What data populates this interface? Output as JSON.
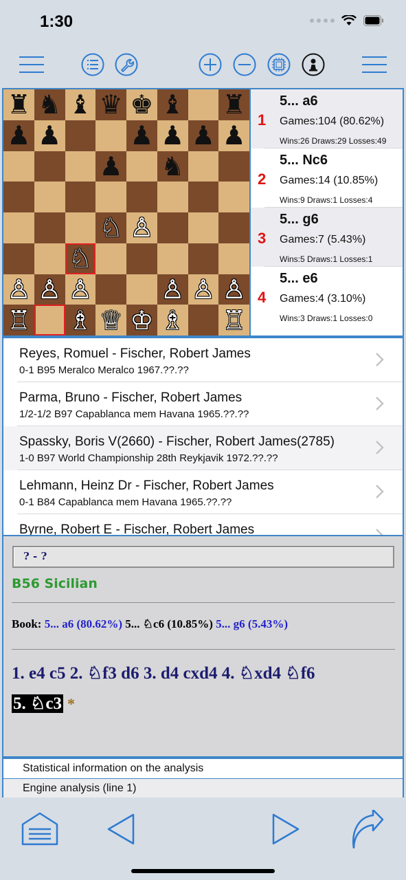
{
  "status": {
    "time": "1:30"
  },
  "colors": {
    "accent": "#3f86c8",
    "rank": "#e01414",
    "opening": "#2e9a32",
    "notation": "#1c1c6e"
  },
  "toolbar": {
    "icons": [
      "menu-icon",
      "list-icon",
      "wrench-icon",
      "zoom-in-icon",
      "zoom-out-icon",
      "engine-chip-icon",
      "pawn-icon",
      "menu-right-icon"
    ]
  },
  "board": {
    "rows": [
      [
        "♜",
        "♞",
        "♝",
        "♛",
        "♚",
        "♝",
        "",
        "♜"
      ],
      [
        "♟",
        "♟",
        "",
        "",
        "♟",
        "♟",
        "♟",
        "♟"
      ],
      [
        "",
        "",
        "",
        "♟",
        "",
        "♞",
        "",
        ""
      ],
      [
        "",
        "",
        "",
        "",
        "",
        "",
        "",
        ""
      ],
      [
        "",
        "",
        "",
        "♘",
        "♙",
        "",
        "",
        ""
      ],
      [
        "",
        "",
        "♘",
        "",
        "",
        "",
        "",
        ""
      ],
      [
        "♙",
        "♙",
        "♙",
        "",
        "",
        "♙",
        "♙",
        "♙"
      ],
      [
        "♖",
        "",
        "♗",
        "♕",
        "♔",
        "♗",
        "",
        "♖"
      ]
    ],
    "colors": [
      [
        "b",
        "b",
        "b",
        "b",
        "b",
        "b",
        "",
        "b"
      ],
      [
        "b",
        "b",
        "",
        "",
        "b",
        "b",
        "b",
        "b"
      ],
      [
        "",
        "",
        "",
        "b",
        "",
        "b",
        "",
        ""
      ],
      [
        "",
        "",
        "",
        "",
        "",
        "",
        "",
        ""
      ],
      [
        "",
        "",
        "",
        "w",
        "w",
        "",
        "",
        ""
      ],
      [
        "",
        "",
        "w",
        "",
        "",
        "",
        "",
        ""
      ],
      [
        "w",
        "w",
        "w",
        "",
        "",
        "w",
        "w",
        "w"
      ],
      [
        "w",
        "",
        "w",
        "w",
        "w",
        "w",
        "",
        "w"
      ]
    ],
    "highlighted": [
      "5-2",
      "7-1"
    ]
  },
  "book": [
    {
      "rank": "1",
      "move": "5... a6",
      "games": "Games:104 (80.62%)",
      "stats": "Wins:26 Draws:29 Losses:49"
    },
    {
      "rank": "2",
      "move": "5... Nc6",
      "games": "Games:14 (10.85%)",
      "stats": "Wins:9 Draws:1 Losses:4"
    },
    {
      "rank": "3",
      "move": "5... g6",
      "games": "Games:7 (5.43%)",
      "stats": "Wins:5 Draws:1 Losses:1"
    },
    {
      "rank": "4",
      "move": "5... e6",
      "games": "Games:4 (3.10%)",
      "stats": "Wins:3 Draws:1 Losses:0"
    }
  ],
  "games": [
    {
      "title": "Reyes, Romuel - Fischer, Robert James",
      "sub": "0-1 B95 Meralco Meralco 1967.??.??"
    },
    {
      "title": "Parma, Bruno - Fischer, Robert James",
      "sub": "1/2-1/2 B97 Capablanca mem Havana 1965.??.??"
    },
    {
      "title": "Spassky, Boris V(2660) - Fischer, Robert James(2785)",
      "sub": "1-0 B97 World Championship 28th Reykjavik 1972.??.??"
    },
    {
      "title": "Lehmann, Heinz Dr - Fischer, Robert James",
      "sub": "0-1 B84 Capablanca mem Havana 1965.??.??"
    },
    {
      "title": "Byrne, Robert E - Fischer, Robert James",
      "sub": ""
    }
  ],
  "notation": {
    "header": "? - ?",
    "opening": "B56 Sicilian",
    "book_label": "Book:",
    "book_line_1": "5... a6 (80.62%)",
    "book_line_2": "5... ♘c6 (10.85%)",
    "book_line_3": "5... g6 (5.43%)",
    "moves": "1. e4 c5 2. ♘f3 d6 3. d4 cxd4 4. ♘xd4 ♘f6",
    "current_move": "5. ♘c3",
    "result": "*"
  },
  "info": {
    "row1": "Statistical information on the analysis",
    "row2": "Engine analysis (line 1)"
  },
  "bottom_bar": {
    "icons": [
      "document-menu-icon",
      "previous-move-icon",
      "next-move-icon",
      "share-icon"
    ]
  }
}
